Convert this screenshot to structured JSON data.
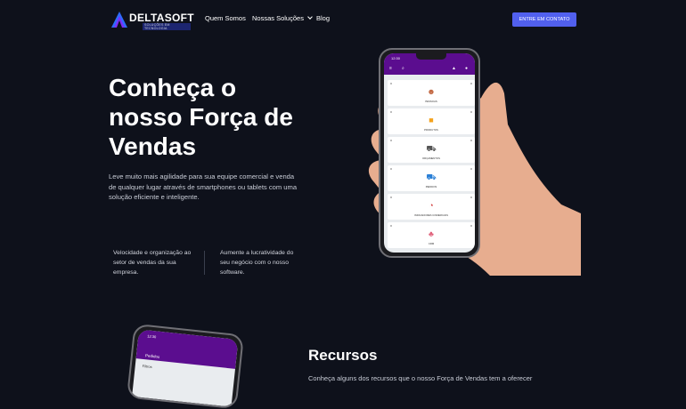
{
  "brand": {
    "name": "DELTASOFT",
    "tagline": "SOLUÇÕES EM TECNOLOGIA"
  },
  "nav": {
    "items": [
      {
        "label": "Quem Somos"
      },
      {
        "label": "Nossas Soluções"
      },
      {
        "label": "Blog"
      }
    ],
    "cta": "ENTRE EM CONTATO"
  },
  "hero": {
    "title_lines": [
      "Conheça o",
      "nosso Força de",
      "Vendas"
    ],
    "description": "Leve muito mais agilidade para sua equipe comercial e venda de qualquer lugar através de smartphones ou tablets com uma solução eficiente e inteligente.",
    "features": [
      "Velocidade e organização ao setor de vendas da sua empresa.",
      "Aumente a lucratividade do seu negócio com o nosso software."
    ]
  },
  "phone": {
    "time": "12:30",
    "cards": [
      {
        "label": "PESSOAS",
        "icon": "person-icon"
      },
      {
        "label": "PRODUTOS",
        "icon": "box-icon"
      },
      {
        "label": "ORÇAMENTOS",
        "icon": "cart-icon"
      },
      {
        "label": "PEDIDOS",
        "icon": "cart-icon"
      },
      {
        "label": "INDICADORES COMERCIAIS",
        "icon": "chart-icon"
      },
      {
        "label": "CRM",
        "icon": "people-icon"
      }
    ]
  },
  "phone2": {
    "time": "12:30",
    "title": "Pedidos",
    "filter": "Filtros"
  },
  "resources": {
    "title": "Recursos",
    "text": "Conheça alguns dos recursos que o nosso Força de Vendas tem a oferecer"
  },
  "colors": {
    "background": "#0e111b",
    "accent": "#5160ee",
    "app_purple": "#5b0d8f"
  }
}
